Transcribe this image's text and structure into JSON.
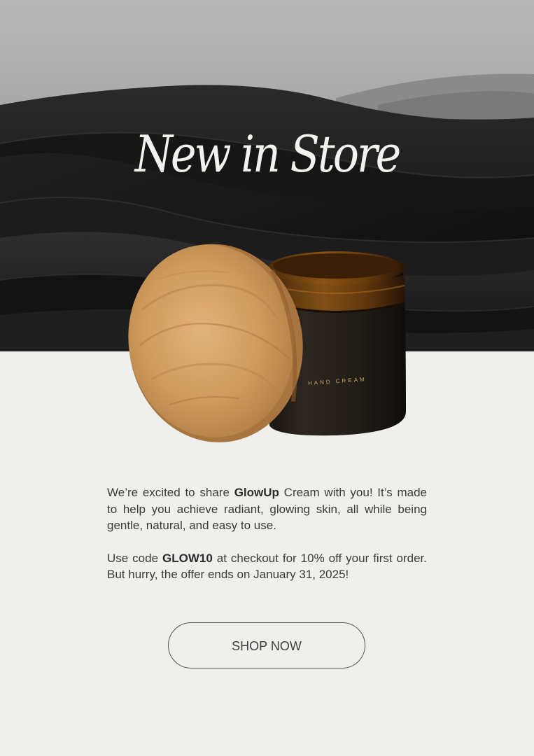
{
  "hero": {
    "headline": "New in Store"
  },
  "product": {
    "jar_label": "HAND CREAM"
  },
  "body_copy": {
    "paragraph1": {
      "before": "We’re excited to share ",
      "bold": "GlowUp",
      "after": " Cream with you! It’s made to help you achieve radiant, glowing skin, all while being gentle, natural, and easy to use."
    },
    "paragraph2": {
      "before": "Use code ",
      "bold": "GLOW10",
      "after": " at checkout for 10% off your first order. But hurry, the offer ends on January 31, 2025!"
    }
  },
  "cta": {
    "label": "SHOP NOW"
  },
  "colors": {
    "background": "#efefec",
    "hero_dark": "#111111",
    "headline": "#f4f2ee",
    "jar_gold_text": "#c9a765",
    "button_border": "#555555"
  }
}
